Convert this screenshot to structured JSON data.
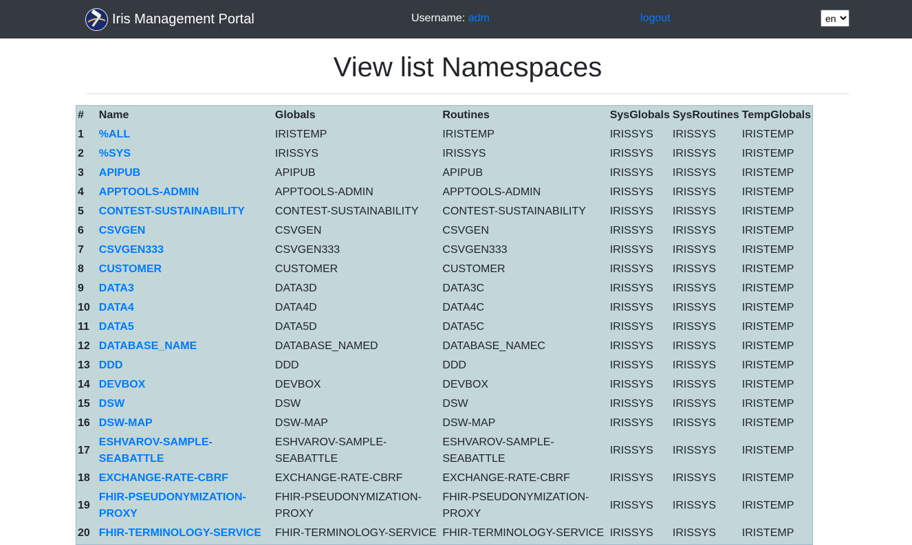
{
  "app": {
    "title": "Iris Management Portal",
    "username_label": "Username:",
    "username": "adm",
    "logout_label": "logout",
    "language": "en",
    "accent_color": "#007bff",
    "navbar_color": "#343a40",
    "logo_icon": "hammer-logo-icon"
  },
  "page": {
    "title": "View list Namespaces"
  },
  "table": {
    "background_color": "#c3d7d8",
    "headers": [
      "#",
      "Name",
      "Globals",
      "Routines",
      "SysGlobals",
      "SysRoutines",
      "TempGlobals"
    ],
    "rows": [
      [
        "1",
        "%ALL",
        "IRISTEMP",
        "IRISTEMP",
        "IRISSYS",
        "IRISSYS",
        "IRISTEMP"
      ],
      [
        "2",
        "%SYS",
        "IRISSYS",
        "IRISSYS",
        "IRISSYS",
        "IRISSYS",
        "IRISTEMP"
      ],
      [
        "3",
        "APIPUB",
        "APIPUB",
        "APIPUB",
        "IRISSYS",
        "IRISSYS",
        "IRISTEMP"
      ],
      [
        "4",
        "APPTOOLS-ADMIN",
        "APPTOOLS-ADMIN",
        "APPTOOLS-ADMIN",
        "IRISSYS",
        "IRISSYS",
        "IRISTEMP"
      ],
      [
        "5",
        "CONTEST-SUSTAINABILITY",
        "CONTEST-SUSTAINABILITY",
        "CONTEST-SUSTAINABILITY",
        "IRISSYS",
        "IRISSYS",
        "IRISTEMP"
      ],
      [
        "6",
        "CSVGEN",
        "CSVGEN",
        "CSVGEN",
        "IRISSYS",
        "IRISSYS",
        "IRISTEMP"
      ],
      [
        "7",
        "CSVGEN333",
        "CSVGEN333",
        "CSVGEN333",
        "IRISSYS",
        "IRISSYS",
        "IRISTEMP"
      ],
      [
        "8",
        "CUSTOMER",
        "CUSTOMER",
        "CUSTOMER",
        "IRISSYS",
        "IRISSYS",
        "IRISTEMP"
      ],
      [
        "9",
        "DATA3",
        "DATA3D",
        "DATA3C",
        "IRISSYS",
        "IRISSYS",
        "IRISTEMP"
      ],
      [
        "10",
        "DATA4",
        "DATA4D",
        "DATA4C",
        "IRISSYS",
        "IRISSYS",
        "IRISTEMP"
      ],
      [
        "11",
        "DATA5",
        "DATA5D",
        "DATA5C",
        "IRISSYS",
        "IRISSYS",
        "IRISTEMP"
      ],
      [
        "12",
        "DATABASE_NAME",
        "DATABASE_NAMED",
        "DATABASE_NAMEC",
        "IRISSYS",
        "IRISSYS",
        "IRISTEMP"
      ],
      [
        "13",
        "DDD",
        "DDD",
        "DDD",
        "IRISSYS",
        "IRISSYS",
        "IRISTEMP"
      ],
      [
        "14",
        "DEVBOX",
        "DEVBOX",
        "DEVBOX",
        "IRISSYS",
        "IRISSYS",
        "IRISTEMP"
      ],
      [
        "15",
        "DSW",
        "DSW",
        "DSW",
        "IRISSYS",
        "IRISSYS",
        "IRISTEMP"
      ],
      [
        "16",
        "DSW-MAP",
        "DSW-MAP",
        "DSW-MAP",
        "IRISSYS",
        "IRISSYS",
        "IRISTEMP"
      ],
      [
        "17",
        "ESHVAROV-SAMPLE-SEABATTLE",
        "ESHVAROV-SAMPLE-SEABATTLE",
        "ESHVAROV-SAMPLE-SEABATTLE",
        "IRISSYS",
        "IRISSYS",
        "IRISTEMP"
      ],
      [
        "18",
        "EXCHANGE-RATE-CBRF",
        "EXCHANGE-RATE-CBRF",
        "EXCHANGE-RATE-CBRF",
        "IRISSYS",
        "IRISSYS",
        "IRISTEMP"
      ],
      [
        "19",
        "FHIR-PSEUDONYMIZATION-PROXY",
        "FHIR-PSEUDONYMIZATION-PROXY",
        "FHIR-PSEUDONYMIZATION-PROXY",
        "IRISSYS",
        "IRISSYS",
        "IRISTEMP"
      ],
      [
        "20",
        "FHIR-TERMINOLOGY-SERVICE",
        "FHIR-TERMINOLOGY-SERVICE",
        "FHIR-TERMINOLOGY-SERVICE",
        "IRISSYS",
        "IRISSYS",
        "IRISTEMP"
      ]
    ]
  }
}
